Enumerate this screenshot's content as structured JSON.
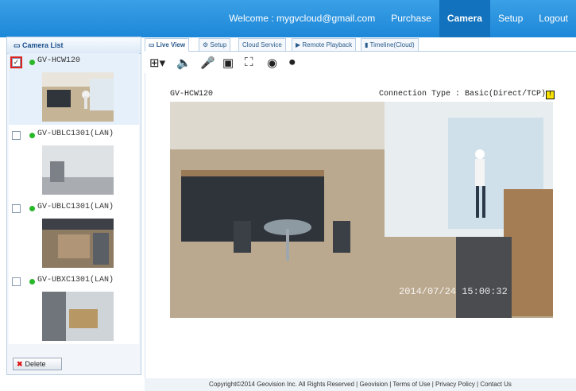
{
  "nav": {
    "welcome": "Welcome : mygvcloud@gmail.com",
    "items": [
      "Purchase",
      "Camera",
      "Setup",
      "Logout"
    ],
    "active": "Camera"
  },
  "sidebar": {
    "title": "Camera List",
    "cameras": [
      {
        "name": "GV-HCW120",
        "checked": true
      },
      {
        "name": "GV-UBLC1301(LAN)",
        "checked": false
      },
      {
        "name": "GV-UBLC1301(LAN)",
        "checked": false
      },
      {
        "name": "GV-UBXC1301(LAN)",
        "checked": false
      }
    ],
    "delete_label": "Delete"
  },
  "tabs": [
    "Live View",
    "Setup",
    "Cloud Service",
    "Remote Playback",
    "Timeline(Cloud)"
  ],
  "viewer": {
    "camera_name": "GV-HCW120",
    "connection_type": "Connection Type : Basic(Direct/TCP)",
    "timestamp": "2014/07/24   15:00:32"
  },
  "footer": {
    "copyright": "Copyright©2014 Geovision Inc. All Rights Reserved | Geovision | Terms of Use | Privacy Policy | Contact Us"
  }
}
